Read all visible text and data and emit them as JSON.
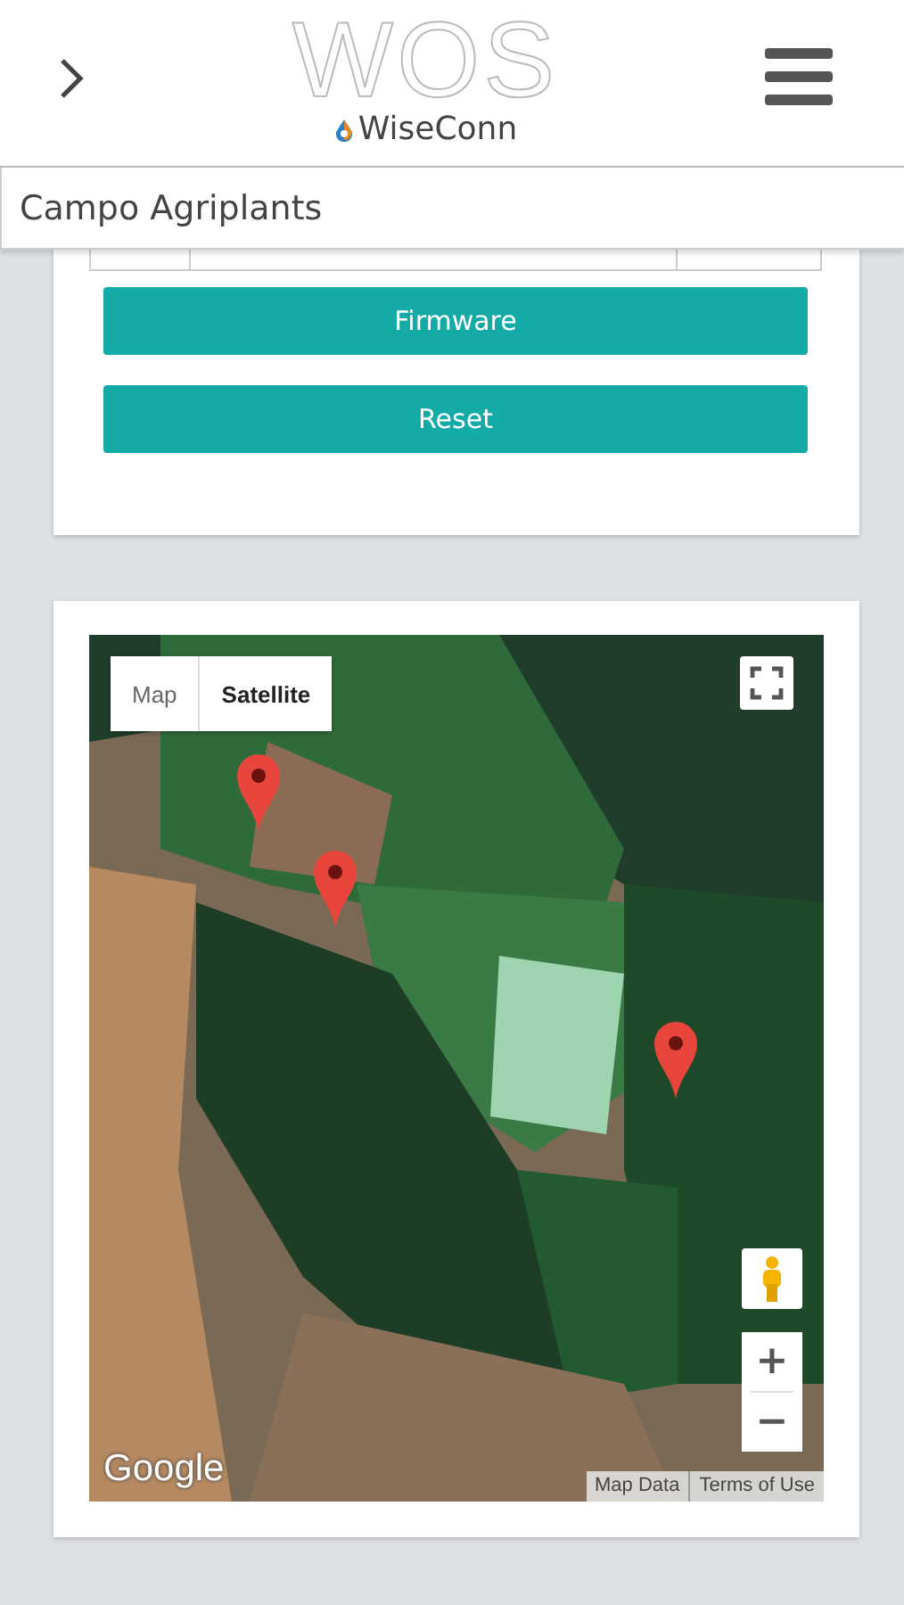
{
  "header": {
    "logo_title": "WOS",
    "logo_brand": "WiseConn"
  },
  "location": "Campo Agriplants",
  "buttons": [
    {
      "label": "Firmware"
    },
    {
      "label": "Reset"
    }
  ],
  "map": {
    "map_types": [
      {
        "label": "Map",
        "selected": false
      },
      {
        "label": "Satellite",
        "selected": true
      }
    ],
    "zoom_in": "+",
    "zoom_out": "−",
    "provider": "Google",
    "footer_links": [
      "Map Data",
      "Terms of Use"
    ]
  }
}
